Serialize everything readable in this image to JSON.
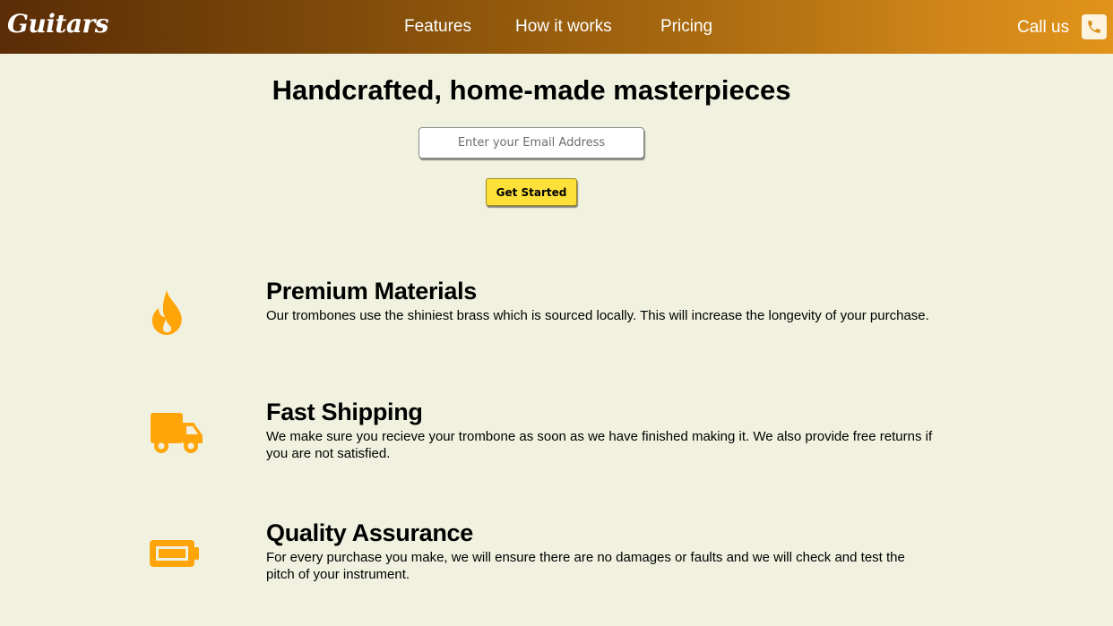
{
  "header": {
    "logo": "Guitars",
    "nav": [
      {
        "label": "Features"
      },
      {
        "label": "How it works"
      },
      {
        "label": "Pricing"
      }
    ],
    "call_label": "Call us",
    "phone_icon": "phone-icon"
  },
  "hero": {
    "title": "Handcrafted, home-made masterpieces",
    "email_placeholder": "Enter your Email Address",
    "button_label": "Get Started"
  },
  "features": [
    {
      "icon": "fire-icon",
      "title": "Premium Materials",
      "description": "Our trombones use the shiniest brass which is sourced locally. This will increase the longevity of your purchase."
    },
    {
      "icon": "truck-icon",
      "title": "Fast Shipping",
      "description": "We make sure you recieve your trombone as soon as we have finished making it. We also provide free returns if you are not satisfied."
    },
    {
      "icon": "battery-icon",
      "title": "Quality Assurance",
      "description": "For every purchase you make, we will ensure there are no damages or faults and we will check and test the pitch of your instrument."
    }
  ],
  "colors": {
    "header_gradient_start": "#5b2c06",
    "header_gradient_end": "#e09419",
    "background": "#f1f1e0",
    "accent_icon": "#ffa50a",
    "button": "#fde13a"
  }
}
